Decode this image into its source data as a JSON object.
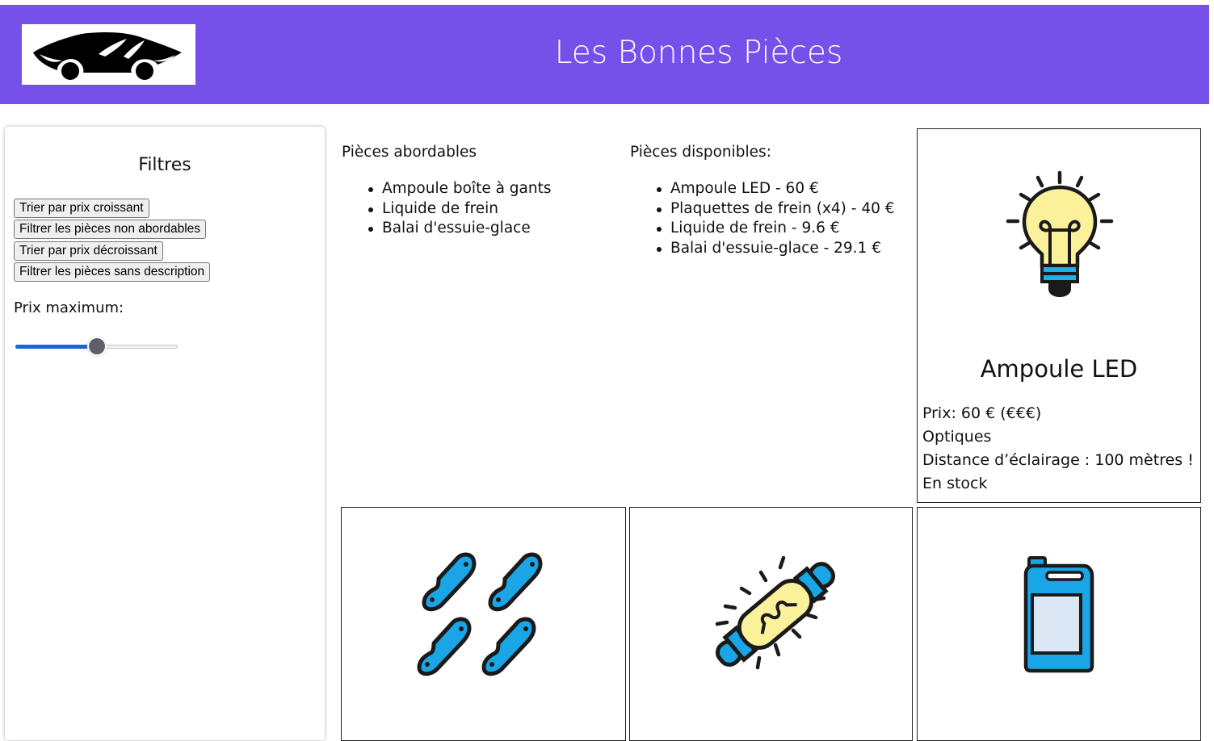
{
  "header": {
    "title": "Les Bonnes Pièces",
    "background_color": "#7551ea",
    "logo_icon": "car-silhouette-icon"
  },
  "filters": {
    "title": "Filtres",
    "buttons": [
      "Trier par prix croissant",
      "Filtrer les pièces non abordables",
      "Trier par prix décroissant",
      "Filtrer les pièces sans description"
    ],
    "price_label": "Prix maximum:",
    "slider_level_percent": 50,
    "slider_accent": "#1a66d9"
  },
  "affordable": {
    "title": "Pièces abordables",
    "items": [
      "Ampoule boîte à gants",
      "Liquide de frein",
      "Balai d'essuie-glace"
    ]
  },
  "available": {
    "title": "Pièces disponibles:",
    "items": [
      "Ampoule LED - 60 €",
      "Plaquettes de frein (x4) - 40 €",
      "Liquide de frein - 9.6 €",
      "Balai d'essuie-glace - 29.1 €"
    ]
  },
  "cards": [
    {
      "icon": "lightbulb-icon",
      "name": "Ampoule LED",
      "price": "Prix: 60 € (€€€)",
      "category": "Optiques",
      "description": "Distance d’éclairage : 100 mètres !",
      "stock": "En stock"
    },
    {
      "icon": "brake-pads-icon"
    },
    {
      "icon": "glovebox-bulb-icon"
    },
    {
      "icon": "brake-fluid-jerrycan-icon"
    }
  ]
}
